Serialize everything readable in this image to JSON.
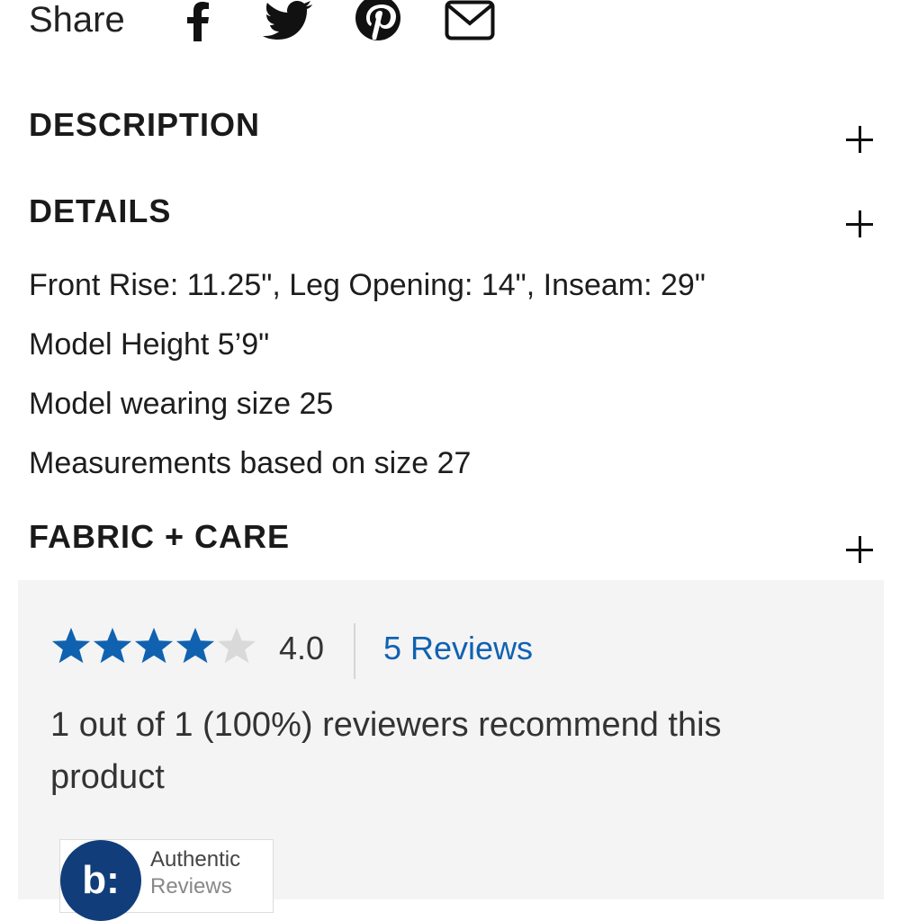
{
  "share": {
    "label": "Share",
    "icons": [
      "facebook-icon",
      "twitter-icon",
      "pinterest-icon",
      "email-icon"
    ]
  },
  "sections": {
    "description": {
      "title": "DESCRIPTION"
    },
    "details": {
      "title": "DETAILS",
      "lines": [
        "Front Rise: 11.25\", Leg Opening: 14\", Inseam: 29\"",
        "Model Height 5’9\"",
        "Model wearing size 25",
        "Measurements based on size 27"
      ]
    },
    "fabric_care": {
      "title": "FABRIC + CARE"
    }
  },
  "reviews": {
    "rating": 4.0,
    "rating_text": "4.0",
    "stars_filled": 4,
    "stars_total": 5,
    "count_link": "5 Reviews",
    "recommend_text": "1 out of 1 (100%) reviewers recommend this product",
    "badge": {
      "logo": "b:",
      "line1": "Authentic",
      "line2": "Reviews"
    }
  },
  "colors": {
    "star_filled": "#1062b1",
    "star_empty": "#d9d9d9",
    "link": "#1062b1",
    "panel_bg": "#f4f4f4",
    "badge_logo_bg": "#113e7a"
  }
}
